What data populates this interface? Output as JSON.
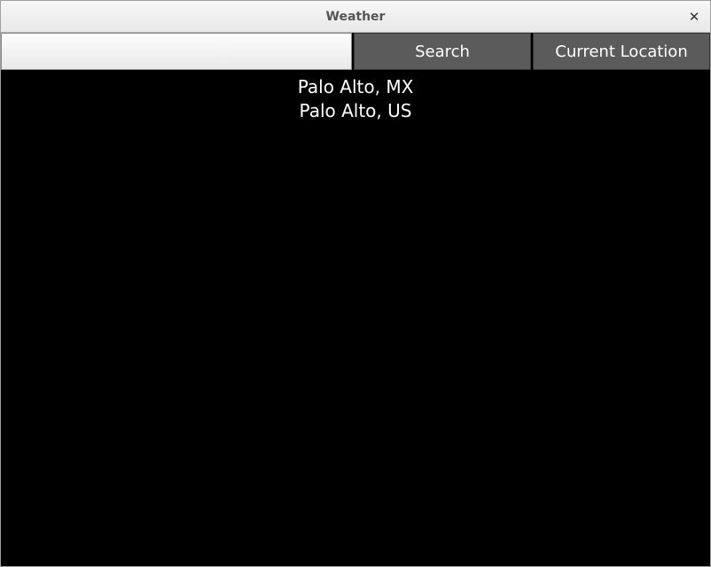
{
  "window": {
    "title": "Weather"
  },
  "toolbar": {
    "search_value": "",
    "search_placeholder": "",
    "search_btn_label": "Search",
    "location_btn_label": "Current Location"
  },
  "results": [
    {
      "label": "Palo Alto, MX"
    },
    {
      "label": "Palo Alto, US"
    }
  ]
}
